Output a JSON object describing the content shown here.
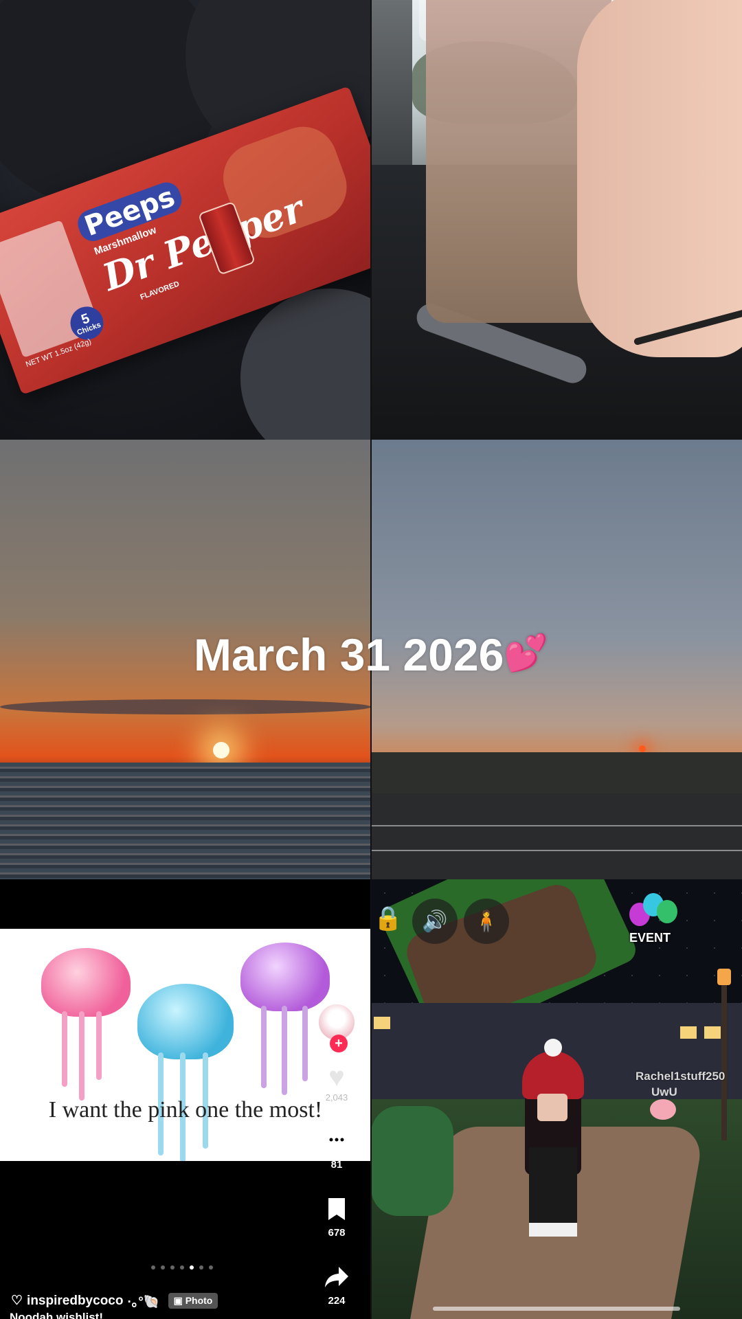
{
  "overlay": {
    "date_text": "March 31 2026",
    "emoji": "💕"
  },
  "tile_snack": {
    "brand": "Peeps",
    "brand_sub": "Marshmallow",
    "flavor_brand": "Dr Pepper",
    "flavored": "FLAVORED",
    "chicks_count": "5",
    "chicks_label": "Chicks",
    "net_weight": "NET WT 1.5oz (42g)"
  },
  "tile_tiktok": {
    "caption_overlay": "I want the pink one the most!",
    "like_count": "2,043",
    "comment_count": "81",
    "bookmark_count": "678",
    "share_count": "224",
    "author": "inspiredbycoco",
    "author_decor": "·｡°🐚",
    "photo_label": "Photo",
    "description": "Noodah wishlist!",
    "carousel_total": 7,
    "carousel_active": 5,
    "icons": {
      "heart": "heart-icon",
      "comment": "comment-icon",
      "bookmark": "bookmark-icon",
      "share": "share-icon"
    }
  },
  "tile_game": {
    "event_label": "EVENT",
    "player_name": "Rachel1stuff250",
    "player_tag": "UwU",
    "icons": {
      "lock": "lock-icon",
      "volume": "volume-icon",
      "avatar": "avatar-icon"
    }
  }
}
